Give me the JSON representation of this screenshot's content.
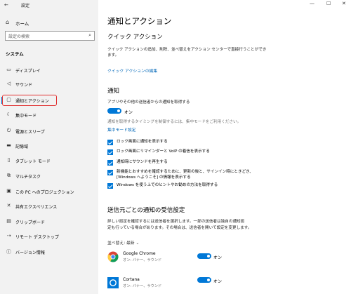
{
  "window": {
    "title": "設定",
    "back_icon": "←",
    "minimize": "—",
    "maximize": "☐",
    "close": "✕"
  },
  "sidebar": {
    "home": {
      "icon": "⌂",
      "label": "ホーム"
    },
    "search_placeholder": "設定の検索",
    "search_icon": "⌕",
    "section": "システム",
    "items": [
      {
        "icon": "▭",
        "label": "ディスプレイ"
      },
      {
        "icon": "◁",
        "label": "サウンド"
      },
      {
        "icon": "▢",
        "label": "通知とアクション"
      },
      {
        "icon": "☾",
        "label": "集中モード"
      },
      {
        "icon": "⏻",
        "label": "電源とスリープ"
      },
      {
        "icon": "▬",
        "label": "記憶域"
      },
      {
        "icon": "▯",
        "label": "タブレット モード"
      },
      {
        "icon": "⧉",
        "label": "マルチタスク"
      },
      {
        "icon": "▣",
        "label": "この PC へのプロジェクション"
      },
      {
        "icon": "✕",
        "label": "共有エクスペリエンス"
      },
      {
        "icon": "▤",
        "label": "クリップボード"
      },
      {
        "icon": "⇢",
        "label": "リモート デスクトップ"
      },
      {
        "icon": "ⓘ",
        "label": "バージョン情報"
      }
    ]
  },
  "main": {
    "title": "通知とアクション",
    "quick": {
      "heading": "クイック アクション",
      "desc_line1": "クイック アクションの追加、削除、並べ替えをアクション センターで直接行うことができ",
      "desc_line2": "ます。",
      "link": "クイック アクションの編集"
    },
    "notifications": {
      "heading": "通知",
      "toggle_desc": "アプリやその他の送信者からの通知を取得する",
      "toggle_state": "オン",
      "note": "通知を取得するタイミングを制御するには、集中モードをご利用ください。",
      "link": "集中モード設定",
      "checkboxes": [
        {
          "label": "ロック画面に通知を表示する",
          "checked": true
        },
        {
          "label": "ロック画面にリマインダーと VoIP の着信を表示する",
          "checked": true
        },
        {
          "label": "通知時にサウンドを再生する",
          "checked": true
        },
        {
          "label": "新機能とおすすめを確認するために、更新の後と、サインイン時にときどき、",
          "label2": "[Windows へようこそ] の情報を表示する",
          "checked": true
        },
        {
          "label": "Windows を使う上でのヒントやお勧めの方法を取得する",
          "checked": true
        }
      ]
    },
    "per_sender": {
      "heading": "送信元ごとの通知の受信設定",
      "desc_line1": "詳しい設定を確認するには送信者を選択します。一部の送信者は独自の通知設",
      "desc_line2": "定も行っている場合があります。その場合は、送信者を開いて設定を変更します。",
      "sort_label": "並べ替え:",
      "sort_value": "最新",
      "sort_icon": "⌄",
      "apps": [
        {
          "name": "Google Chrome",
          "sub": "オン: バナー、サウンド",
          "state": "オン",
          "icon": "chrome-icon"
        },
        {
          "name": "Cortana",
          "sub": "オン: バナー、サウンド",
          "state": "オン",
          "icon": "cortana-icon"
        }
      ]
    }
  },
  "colors": {
    "accent": "#0078d7",
    "link": "#0067b8",
    "highlight": "#e03030",
    "sidebar_bg": "#f2f2f2"
  }
}
